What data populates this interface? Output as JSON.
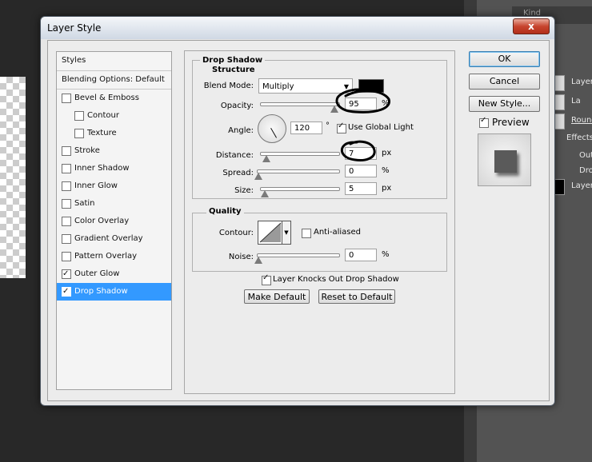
{
  "window": {
    "title": "Layer Style",
    "close_glyph": "x"
  },
  "background_panel": {
    "kind_label": "Kind",
    "layers": [
      "Layer",
      "La",
      "Round",
      "Effects",
      "Out",
      "Dro",
      "Layer"
    ]
  },
  "sidebar": {
    "header": "Styles",
    "blending": "Blending Options: Default",
    "items": [
      {
        "label": "Bevel & Emboss",
        "checked": false,
        "indent": false
      },
      {
        "label": "Contour",
        "checked": false,
        "indent": true
      },
      {
        "label": "Texture",
        "checked": false,
        "indent": true
      },
      {
        "label": "Stroke",
        "checked": false,
        "indent": false
      },
      {
        "label": "Inner Shadow",
        "checked": false,
        "indent": false
      },
      {
        "label": "Inner Glow",
        "checked": false,
        "indent": false
      },
      {
        "label": "Satin",
        "checked": false,
        "indent": false
      },
      {
        "label": "Color Overlay",
        "checked": false,
        "indent": false
      },
      {
        "label": "Gradient Overlay",
        "checked": false,
        "indent": false
      },
      {
        "label": "Pattern Overlay",
        "checked": false,
        "indent": false
      },
      {
        "label": "Outer Glow",
        "checked": true,
        "indent": false
      },
      {
        "label": "Drop Shadow",
        "checked": true,
        "indent": false,
        "selected": true
      }
    ]
  },
  "drop_shadow": {
    "section_title": "Drop Shadow",
    "structure_title": "Structure",
    "blend_mode_label": "Blend Mode:",
    "blend_mode_value": "Multiply",
    "shadow_color": "#000000",
    "opacity_label": "Opacity:",
    "opacity_value": "95",
    "opacity_unit": "%",
    "opacity_level": 0.95,
    "angle_label": "Angle:",
    "angle_value": "120",
    "angle_unit": "°",
    "use_global_light_label": "Use Global Light",
    "use_global_light": true,
    "distance_label": "Distance:",
    "distance_value": "7",
    "distance_unit": "px",
    "spread_label": "Spread:",
    "spread_value": "0",
    "spread_unit": "%",
    "size_label": "Size:",
    "size_value": "5",
    "size_unit": "px",
    "quality_title": "Quality",
    "contour_label": "Contour:",
    "anti_aliased_label": "Anti-aliased",
    "anti_aliased": false,
    "noise_label": "Noise:",
    "noise_value": "0",
    "noise_unit": "%",
    "knockout_label": "Layer Knocks Out Drop Shadow",
    "knockout": true,
    "make_default_label": "Make Default",
    "reset_default_label": "Reset to Default"
  },
  "actions": {
    "ok": "OK",
    "cancel": "Cancel",
    "new_style": "New Style...",
    "preview_label": "Preview",
    "preview_checked": true
  },
  "colors": {
    "selection": "#3399ff",
    "annotation": "#000000"
  }
}
